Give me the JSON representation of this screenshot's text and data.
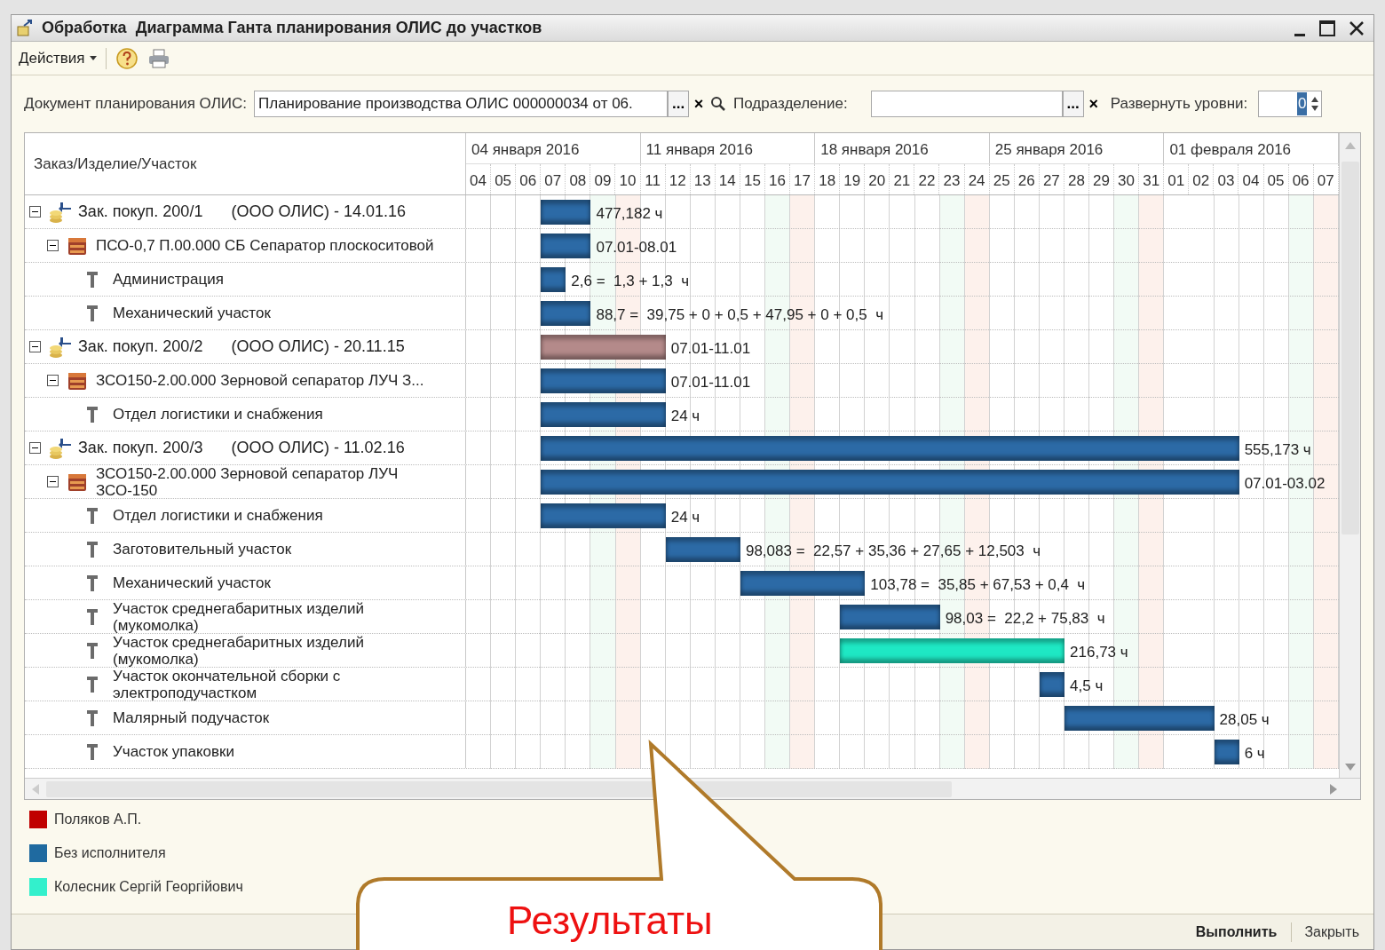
{
  "window": {
    "title": "Обработка  Диаграмма Ганта планирования ОЛИС до участков"
  },
  "toolbar": {
    "actions": "Действия"
  },
  "form": {
    "document_label": "Документ планирования ОЛИС:",
    "document_value": "Планирование производства ОЛИС 000000034 от 06.",
    "select_button": "...",
    "clear_button": "×",
    "division_label": "Подразделение:",
    "division_select": "...",
    "division_clear": "×",
    "levels_label": "Развернуть уровни:",
    "levels_value": "0"
  },
  "grid": {
    "column_header": "Заказ/Изделие/Участок",
    "weeks": [
      "04 января 2016",
      "11 января 2016",
      "18 января 2016",
      "25 января 2016",
      "01 февраля 2016"
    ],
    "days": [
      "04",
      "05",
      "06",
      "07",
      "08",
      "09",
      "10",
      "11",
      "12",
      "13",
      "14",
      "15",
      "16",
      "17",
      "18",
      "19",
      "20",
      "21",
      "22",
      "23",
      "24",
      "25",
      "26",
      "27",
      "28",
      "29",
      "30",
      "31",
      "01",
      "02",
      "03",
      "04",
      "05",
      "06",
      "07"
    ],
    "orders": [
      {
        "label": "Зак. покуп. 200/1",
        "customer": "(ООО ОЛИС) - 14.01.16",
        "expanded": true,
        "bar": {
          "color": "#2c6aa6",
          "label": "477,182 ч"
        },
        "children": [
          {
            "label": "ПСО-0,7 П.00.000 СБ Сепаратор плоскоситовой",
            "expanded": true,
            "bar": {
              "color": "#2c6aa6",
              "label": "07.01-08.01"
            },
            "children": [
              {
                "label": "Администрация",
                "bar": {
                  "color": "#2c6aa6",
                  "label": "2,6 =  1,3 + 1,3  ч"
                }
              },
              {
                "label": "Механический участок",
                "bar": {
                  "color": "#2c6aa6",
                  "label": "88,7 =  39,75 + 0 + 0,5 + 47,95 + 0 + 0,5  ч"
                }
              }
            ]
          }
        ]
      },
      {
        "label": "Зак. покуп. 200/2",
        "customer": "(ООО ОЛИС) - 20.11.15",
        "expanded": true,
        "bar": {
          "color": "#b48a8a",
          "label": "07.01-11.01"
        },
        "children": [
          {
            "label": "ЗСО150-2.00.000  Зерновой  сепаратор ЛУЧ З...",
            "expanded": true,
            "bar": {
              "color": "#2c6aa6",
              "label": "07.01-11.01"
            },
            "children": [
              {
                "label": "Отдел логистики и снабжения",
                "bar": {
                  "color": "#2c6aa6",
                  "label": "24 ч"
                }
              }
            ]
          }
        ]
      },
      {
        "label": "Зак. покуп. 200/3",
        "customer": "(ООО ОЛИС) - 11.02.16",
        "expanded": true,
        "bar": {
          "color": "#2c6aa6",
          "label": "555,173 ч"
        },
        "children": [
          {
            "label": "ЗСО150-2.00.000 Зерновой сепаратор ЛУЧ ЗСО-150",
            "expanded": true,
            "bar": {
              "color": "#2c6aa6",
              "label": "07.01-03.02"
            },
            "children": [
              {
                "label": "Отдел логистики и снабжения",
                "bar": {
                  "color": "#2c6aa6",
                  "label": "24 ч"
                }
              },
              {
                "label": "Заготовительный участок",
                "bar": {
                  "color": "#2c6aa6",
                  "label": "98,083 =  22,57 + 35,36 + 27,65 + 12,503  ч"
                }
              },
              {
                "label": "Механический участок",
                "bar": {
                  "color": "#2c6aa6",
                  "label": "103,78 =  35,85 + 67,53 + 0,4  ч"
                }
              },
              {
                "label": "Участок среднегабаритных изделий (мукомолка)",
                "bar": {
                  "color": "#2c6aa6",
                  "label": "98,03 =  22,2 + 75,83  ч"
                }
              },
              {
                "label": "Участок среднегабаритных изделий (мукомолка)",
                "bar": {
                  "color": "#1ee8c4",
                  "label": "216,73 ч"
                }
              },
              {
                "label": "Участок окончательной сборки с электроподучастком",
                "bar": {
                  "color": "#2c6aa6",
                  "label": "4,5 ч"
                }
              },
              {
                "label": "Малярный подучасток",
                "bar": {
                  "color": "#2c6aa6",
                  "label": "28,05 ч"
                }
              },
              {
                "label": "Участок упаковки",
                "bar": {
                  "color": "#2c6aa6",
                  "label": "6 ч"
                }
              }
            ]
          }
        ]
      }
    ]
  },
  "legend": [
    {
      "name": "Поляков А.П.",
      "color": "#c00000"
    },
    {
      "name": "Без исполнителя",
      "color": "#1f6aa0"
    },
    {
      "name": "Колесник Сергій Георгійович",
      "color": "#33f0cc"
    }
  ],
  "callout": {
    "text": "Результаты"
  },
  "buttons": {
    "run": "Выполнить",
    "close": "Закрыть"
  }
}
